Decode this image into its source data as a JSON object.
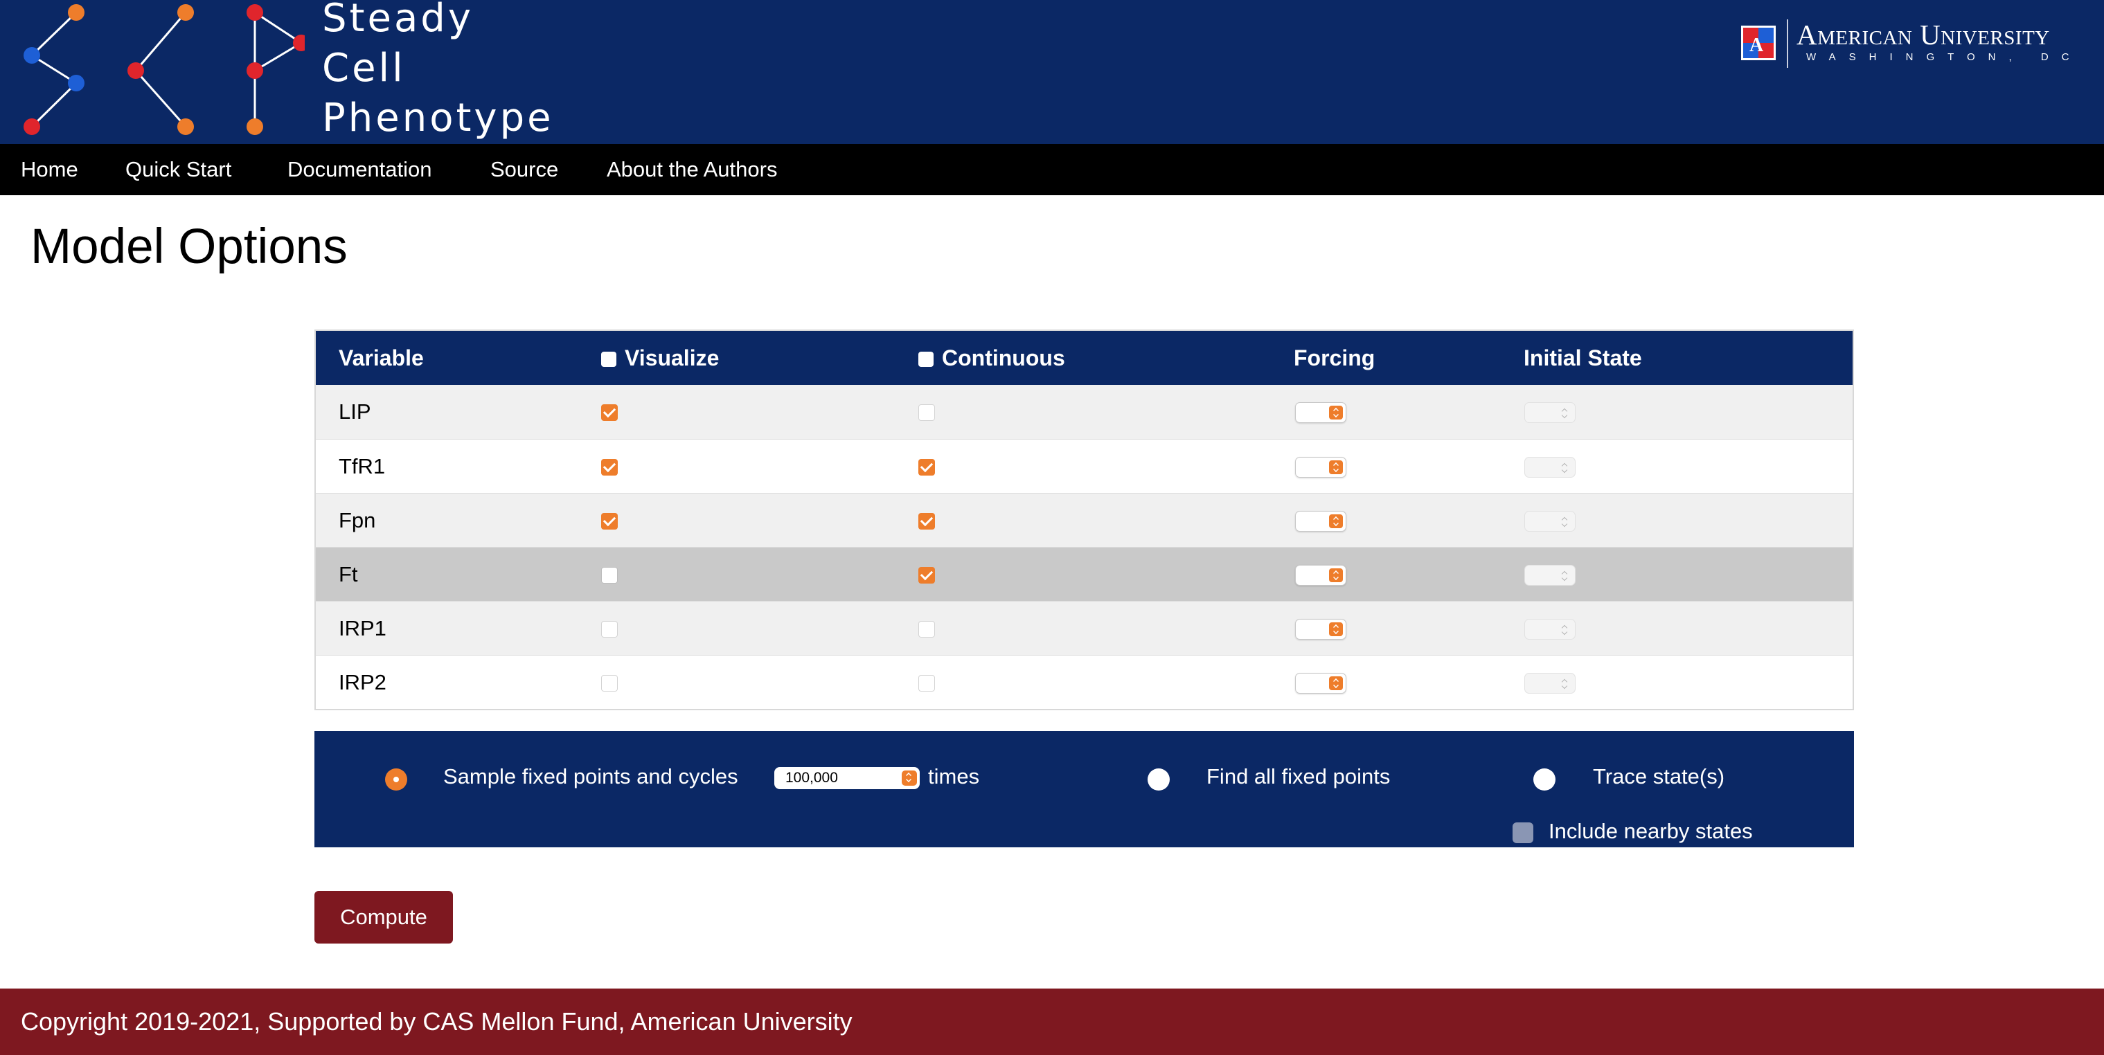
{
  "header": {
    "title_lines": [
      "Steady",
      "Cell",
      "Phenotype"
    ],
    "university": {
      "name": "American University",
      "subtitle": "WASHINGTON, DC"
    }
  },
  "nav": {
    "items": [
      {
        "label": "Home"
      },
      {
        "label": "Quick Start"
      },
      {
        "label": "Documentation"
      },
      {
        "label": "Source"
      },
      {
        "label": "About the Authors"
      }
    ]
  },
  "page_title": "Model Options",
  "table": {
    "headers": {
      "variable": "Variable",
      "visualize": "Visualize",
      "continuous": "Continuous",
      "forcing": "Forcing",
      "initial_state": "Initial State"
    },
    "rows": [
      {
        "name": "LIP",
        "visualize": true,
        "continuous": false
      },
      {
        "name": "TfR1",
        "visualize": true,
        "continuous": true
      },
      {
        "name": "Fpn",
        "visualize": true,
        "continuous": true
      },
      {
        "name": "Ft",
        "visualize": false,
        "continuous": true
      },
      {
        "name": "IRP1",
        "visualize": false,
        "continuous": false
      },
      {
        "name": "IRP2",
        "visualize": false,
        "continuous": false
      }
    ]
  },
  "options": {
    "sample_label": "Sample fixed points and cycles",
    "sample_value": "100,000",
    "times_label": "times",
    "fixed_points_label": "Find all fixed points",
    "trace_label": "Trace state(s)",
    "include_nearby_label": "Include nearby states",
    "selected": "sample"
  },
  "compute_label": "Compute",
  "footer": "Copyright 2019-2021, Supported by CAS Mellon Fund, American University",
  "colors": {
    "navy": "#0b2865",
    "orange": "#ee7d2b",
    "maroon": "#7e1820",
    "red": "#e0252c",
    "blue": "#1e5fd6"
  }
}
